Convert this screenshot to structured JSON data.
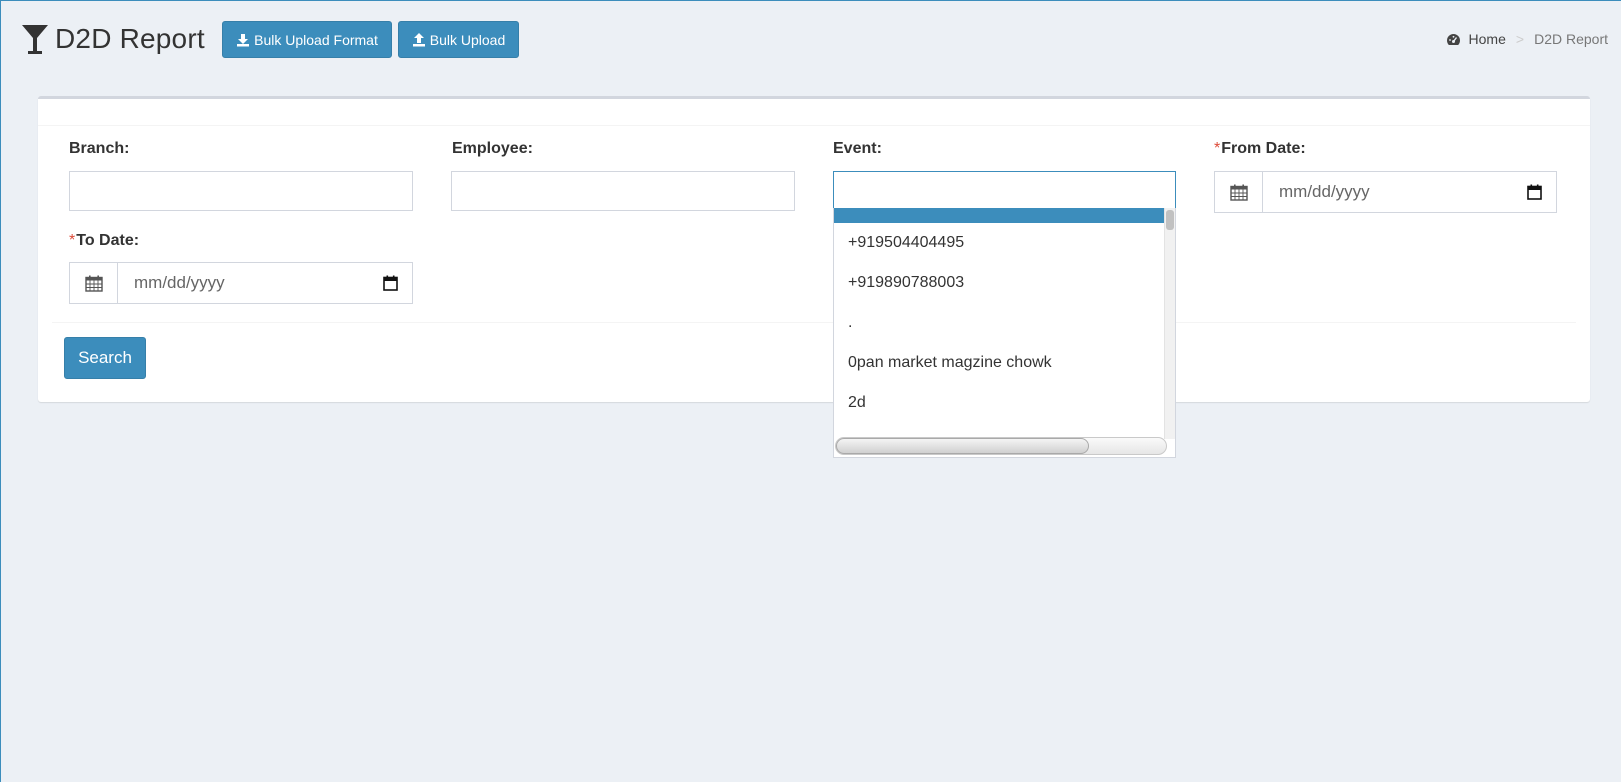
{
  "header": {
    "title": "D2D Report",
    "bulk_upload_format_label": "Bulk Upload Format",
    "bulk_upload_label": "Bulk Upload"
  },
  "breadcrumb": {
    "home": "Home",
    "separator": ">",
    "current": "D2D Report"
  },
  "form": {
    "branch_label": "Branch:",
    "branch_value": "",
    "employee_label": "Employee:",
    "employee_value": "",
    "event_label": "Event:",
    "event_value": "",
    "from_date_label": "From Date:",
    "from_date_placeholder": "mm/dd/yyyy",
    "to_date_label": "To Date:",
    "to_date_placeholder": "mm/dd/yyyy",
    "required_marker": "*",
    "search_label": "Search"
  },
  "event_dropdown": {
    "options": [
      "+919504404495",
      "+919890788003",
      ".",
      "0pan market magzine chowk",
      "2d"
    ]
  },
  "colors": {
    "primary": "#3c8dbc",
    "background": "#ecf0f5",
    "required": "#dd4b39"
  }
}
